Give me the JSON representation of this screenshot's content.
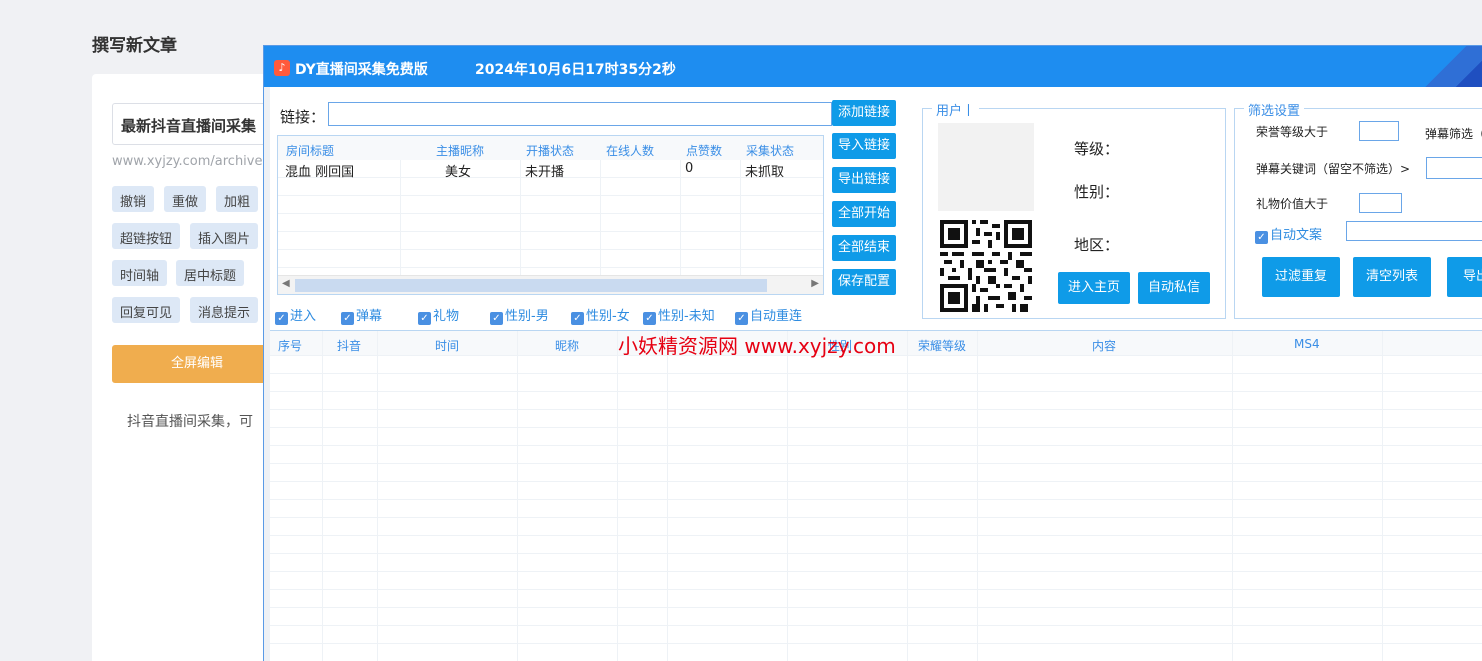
{
  "background": {
    "page_title": "撰写新文章",
    "post_title": "最新抖音直播间采集",
    "post_url": "www.xyjzy.com/archives/",
    "toolbar": [
      "撤销",
      "重做",
      "加粗",
      "超链按钮",
      "插入图片",
      "时间轴",
      "居中标题",
      "回复可见",
      "消息提示"
    ],
    "fullscreen_label": "全屏编辑",
    "body_text": "抖音直播间采集，可"
  },
  "app": {
    "title": "DY直播间采集免费版",
    "datetime": "2024年10月6日17时35分2秒",
    "link_label": "链接：",
    "link_value": "",
    "buttons": {
      "add_link": "添加链接",
      "import_link": "导入链接",
      "export_link": "导出链接",
      "start_all": "全部开始",
      "stop_all": "全部结束",
      "save_config": "保存配置",
      "enter_home": "进入主页",
      "auto_dm": "自动私信",
      "filter_dup": "过滤重复",
      "clear_list": "清空列表",
      "export": "导出"
    },
    "room_table": {
      "columns": [
        "房间标题",
        "主播昵称",
        "开播状态",
        "在线人数",
        "点赞数",
        "采集状态"
      ],
      "rows": [
        {
          "title": "混血 刚回国",
          "anchor": "美女",
          "status": "未开播",
          "online": "",
          "likes": "0",
          "collect": "未抓取"
        }
      ]
    },
    "checkboxes": [
      {
        "label": "进入",
        "checked": true
      },
      {
        "label": "弹幕",
        "checked": true
      },
      {
        "label": "礼物",
        "checked": true
      },
      {
        "label": "性别-男",
        "checked": true
      },
      {
        "label": "性别-女",
        "checked": true
      },
      {
        "label": "性别-未知",
        "checked": true
      },
      {
        "label": "自动重连",
        "checked": true
      }
    ],
    "user_box": {
      "legend": "用户丨",
      "level_label": "等级：",
      "gender_label": "性别：",
      "region_label": "地区："
    },
    "filter_box": {
      "legend": "筛选设置",
      "honor_label": "荣誉等级大于",
      "danmu_filter_label": "弹幕筛选（",
      "keyword_label": "弹幕关键词（留空不筛选）>",
      "gift_label": "礼物价值大于",
      "auto_text_label": "自动文案",
      "auto_text_checked": true
    },
    "main_grid": {
      "columns": [
        "序号",
        "抖音",
        "时间",
        "昵称",
        "性别",
        "荣耀等级",
        "内容",
        "MS4"
      ]
    },
    "watermark": "小妖精资源网 www.xyjzy.com",
    "colors": {
      "titlebar": "#1e8df0",
      "button": "#0f9be8",
      "header_text": "#3a8ee6",
      "watermark": "#e60012"
    }
  }
}
